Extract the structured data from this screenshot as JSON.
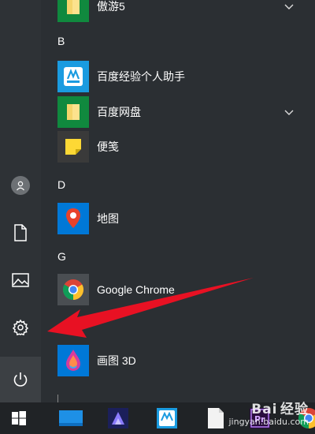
{
  "start_menu": {
    "groups": [
      {
        "letter": "",
        "apps": [
          {
            "label": "傲游5",
            "icon": "folder-icon",
            "expandable": true
          }
        ]
      },
      {
        "letter": "B",
        "apps": [
          {
            "label": "百度经验个人助手",
            "icon": "baidu-jingyan-icon",
            "expandable": false
          },
          {
            "label": "百度网盘",
            "icon": "folder-icon",
            "expandable": true
          },
          {
            "label": "便笺",
            "icon": "sticky-notes-icon",
            "expandable": false
          }
        ]
      },
      {
        "letter": "D",
        "apps": [
          {
            "label": "地图",
            "icon": "maps-icon",
            "expandable": false
          }
        ]
      },
      {
        "letter": "G",
        "apps": [
          {
            "label": "Google Chrome",
            "icon": "chrome-icon",
            "expandable": false
          }
        ]
      },
      {
        "letter": "",
        "apps": [
          {
            "label": "画图 3D",
            "icon": "paint-3d-icon",
            "expandable": false
          }
        ]
      }
    ],
    "rail": [
      "user-icon",
      "documents-icon",
      "pictures-icon",
      "settings-icon",
      "power-icon"
    ]
  },
  "taskbar": {
    "items": [
      "windows-start-icon",
      "desktop-icon",
      "video-editor-icon",
      "baidu-jingyan-icon",
      "file-icon",
      "premiere-icon",
      "chrome-icon"
    ]
  },
  "watermark": {
    "line1": "Bai",
    "line2": "经验",
    "line3": "jingyan.baidu.com"
  },
  "colors": {
    "accent": "#0078d7",
    "tile_green": "#10893e",
    "arrow": "#e81123",
    "menu_bg": "#2b2f33"
  }
}
